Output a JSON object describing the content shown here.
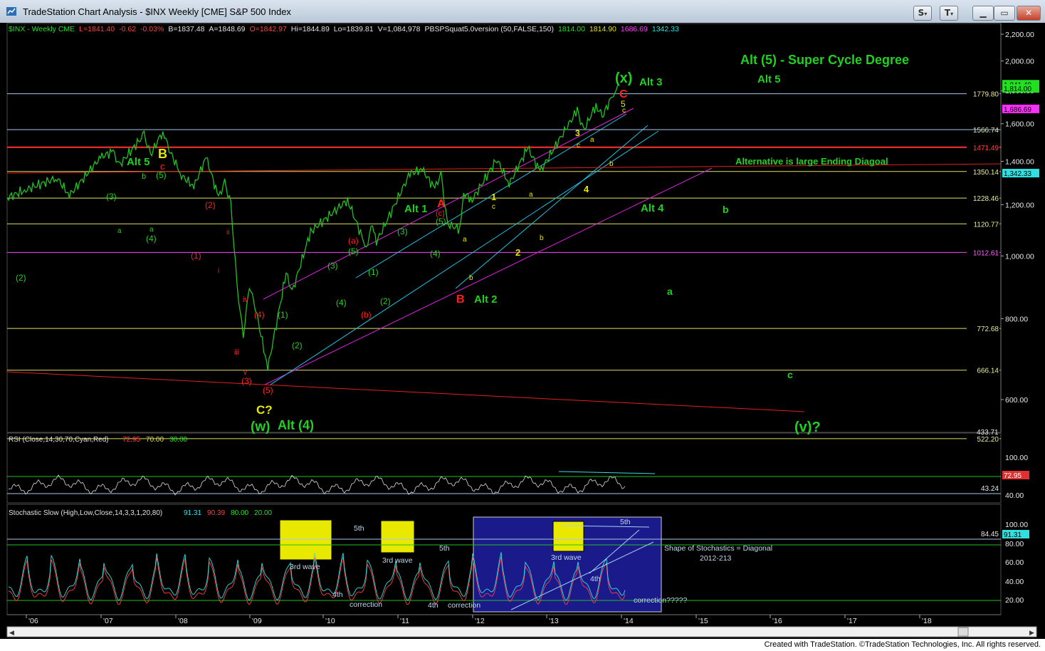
{
  "window": {
    "title": "TradeStation Chart Analysis - $INX Weekly [CME] S&P 500 Index"
  },
  "controls": {
    "s": "S",
    "t": "T"
  },
  "footer": "Created with TradeStation. ©TradeStation Technologies, Inc. All rights reserved.",
  "colors": {
    "green_label": "#22d022",
    "yellow_label": "#e8e800",
    "red_label": "#ff2020",
    "price_bar": "#22c022",
    "cyan_line": "#20c0e0",
    "magenta_line": "#e020e0",
    "red_line": "#e02020"
  },
  "header": {
    "symbol": "$INX - Weekly  CME",
    "L": "L=1841.40",
    "chg": "-0.62",
    "pct": "-0.03%",
    "B": "B=1837.48",
    "A": "A=1848.69",
    "O": "O=1842.97",
    "Hi": "Hi=1844.89",
    "Lo": "Lo=1839.81",
    "V": "V=1,084,978",
    "study": "PBSPSquat5.0version (50,FALSE,150)",
    "s1": "1814.00",
    "s2": "1814.90",
    "s3": "1686.69",
    "s4": "1342.33"
  },
  "chart_data": [
    {
      "type": "line",
      "title": "",
      "xlabel": "",
      "ylabel": "",
      "x_tick_labels": [
        "'06",
        "'07",
        "'08",
        "'09",
        "'10",
        "'11",
        "'12",
        "'13",
        "'14",
        "'15",
        "'16",
        "'17",
        "'18"
      ],
      "y_tick_labels": [
        "2,200.00",
        "2,000.00",
        "1,800.00",
        "1,600.00",
        "1,400.00",
        "1,200.00",
        "1,000.00",
        "800.00",
        "600.00"
      ],
      "ylim": [
        430,
        2260
      ],
      "scale": "log",
      "series": [
        {
          "values_date_close": [
            [
              "2005-09",
              1230
            ],
            [
              "2005-12",
              1265
            ],
            [
              "2006-05",
              1320
            ],
            [
              "2006-07",
              1240
            ],
            [
              "2006-12",
              1420
            ],
            [
              "2007-02",
              1450
            ],
            [
              "2007-03",
              1380
            ],
            [
              "2007-07",
              1540
            ],
            [
              "2007-08",
              1430
            ],
            [
              "2007-10",
              1560
            ],
            [
              "2007-11",
              1460
            ],
            [
              "2008-01",
              1330
            ],
            [
              "2008-03",
              1280
            ],
            [
              "2008-05",
              1420
            ],
            [
              "2008-07",
              1230
            ],
            [
              "2008-08",
              1300
            ],
            [
              "2008-09",
              1200
            ],
            [
              "2008-10",
              900
            ],
            [
              "2008-11",
              750
            ],
            [
              "2008-12",
              900
            ],
            [
              "2009-01",
              830
            ],
            [
              "2009-03",
              670
            ],
            [
              "2009-06",
              940
            ],
            [
              "2009-07",
              880
            ],
            [
              "2009-10",
              1090
            ],
            [
              "2010-04",
              1220
            ],
            [
              "2010-07",
              1030
            ],
            [
              "2010-08",
              1120
            ],
            [
              "2010-08-20",
              1050
            ],
            [
              "2011-02",
              1340
            ],
            [
              "2011-04",
              1360
            ],
            [
              "2011-06",
              1270
            ],
            [
              "2011-07",
              1340
            ],
            [
              "2011-08",
              1120
            ],
            [
              "2011-10",
              1100
            ],
            [
              "2011-10-20",
              1250
            ],
            [
              "2011-12",
              1220
            ],
            [
              "2012-04",
              1410
            ],
            [
              "2012-06",
              1290
            ],
            [
              "2012-09",
              1470
            ],
            [
              "2012-11",
              1350
            ],
            [
              "2013-05",
              1680
            ],
            [
              "2013-06",
              1560
            ],
            [
              "2013-08",
              1710
            ],
            [
              "2013-09",
              1640
            ],
            [
              "2013-11",
              1800
            ],
            [
              "2013-12",
              1841
            ]
          ]
        }
      ],
      "horizontal_levels": [
        {
          "value": 1779.8,
          "label": "1779.80",
          "color": "#a8c8e8"
        },
        {
          "value": 1566.74,
          "label": "1566.74",
          "color": "#e0e060"
        },
        {
          "value": 1471.49,
          "label": "1471.49",
          "color": "#ff3030"
        },
        {
          "value": 1350.14,
          "label": "1350.14",
          "color": "#e0e060"
        },
        {
          "value": 1228.46,
          "label": "1228.46",
          "color": "#e0e060"
        },
        {
          "value": 1120.77,
          "label": "1120.77",
          "color": "#e0e060"
        },
        {
          "value": 1012.61,
          "label": "1012.61",
          "color": "#ff40ff"
        },
        {
          "value": 772.68,
          "label": "772.68",
          "color": "#e0e060"
        },
        {
          "value": 666.14,
          "label": "666.14",
          "color": "#e0e060"
        },
        {
          "value": 522.2,
          "label": "522.20",
          "color": "#e0e060"
        }
      ],
      "axis_tags": [
        {
          "label": "1,841.40",
          "bg": "#20e020",
          "fg": "#000"
        },
        {
          "label": "1,814.00",
          "bg": "#20e020",
          "fg": "#000"
        },
        {
          "label": "1,686.69",
          "bg": "#ff30ff",
          "fg": "#000"
        },
        {
          "label": "1,342.33",
          "bg": "#30e0e0",
          "fg": "#000"
        }
      ],
      "truncated_tick": "433.71",
      "annotations": [
        {
          "text": "Alt (5) - Super Cycle Degree",
          "color": "green"
        },
        {
          "text": "Alt 5",
          "color": "green"
        },
        {
          "text": "(x)",
          "color": "green"
        },
        {
          "text": "Alt 3",
          "color": "green"
        },
        {
          "text": "C",
          "color": "red"
        },
        {
          "text": "5",
          "color": "yellow"
        },
        {
          "text": "c",
          "color": "yellow"
        },
        {
          "text": "Alternative is large Ending Diagoal",
          "color": "green"
        },
        {
          "text": "Alt 4",
          "color": "green"
        },
        {
          "text": "b",
          "color": "green"
        },
        {
          "text": "a",
          "color": "green"
        },
        {
          "text": "c",
          "color": "green"
        },
        {
          "text": "(v)?",
          "color": "green"
        },
        {
          "text": "Alt 5",
          "color": "green"
        },
        {
          "text": "B",
          "color": "yellow"
        },
        {
          "text": "c",
          "color": "red"
        },
        {
          "text": "(5)",
          "color": "green"
        },
        {
          "text": "b",
          "color": "green"
        },
        {
          "text": "(3)",
          "color": "green"
        },
        {
          "text": "a",
          "color": "green"
        },
        {
          "text": "a",
          "color": "green"
        },
        {
          "text": "(4)",
          "color": "green"
        },
        {
          "text": "(2)",
          "color": "green"
        },
        {
          "text": "(2)",
          "color": "red"
        },
        {
          "text": "(1)",
          "color": "red"
        },
        {
          "text": "ii",
          "color": "red"
        },
        {
          "text": "i",
          "color": "red"
        },
        {
          "text": "iv",
          "color": "red"
        },
        {
          "text": "(4)",
          "color": "red"
        },
        {
          "text": "iii",
          "color": "red"
        },
        {
          "text": "v",
          "color": "red"
        },
        {
          "text": "(3)",
          "color": "red"
        },
        {
          "text": "(5)",
          "color": "red"
        },
        {
          "text": "C?",
          "color": "yellow"
        },
        {
          "text": "(w)",
          "color": "green"
        },
        {
          "text": "Alt (4)",
          "color": "green"
        },
        {
          "text": "(1)",
          "color": "green"
        },
        {
          "text": "(2)",
          "color": "green"
        },
        {
          "text": "(3)",
          "color": "green"
        },
        {
          "text": "(4)",
          "color": "green"
        },
        {
          "text": "(a)",
          "color": "red"
        },
        {
          "text": "(5)",
          "color": "green"
        },
        {
          "text": "(1)",
          "color": "green"
        },
        {
          "text": "(2)",
          "color": "green"
        },
        {
          "text": "(b)",
          "color": "red"
        },
        {
          "text": "Alt 1",
          "color": "green"
        },
        {
          "text": "A",
          "color": "red"
        },
        {
          "text": "(c)",
          "color": "red"
        },
        {
          "text": "(3)",
          "color": "green"
        },
        {
          "text": "(5)",
          "color": "green"
        },
        {
          "text": "(4)",
          "color": "green"
        },
        {
          "text": "a",
          "color": "yellow"
        },
        {
          "text": "b",
          "color": "yellow"
        },
        {
          "text": "B",
          "color": "red"
        },
        {
          "text": "Alt 2",
          "color": "green"
        },
        {
          "text": "1",
          "color": "yellow"
        },
        {
          "text": "c",
          "color": "yellow"
        },
        {
          "text": "2",
          "color": "yellow"
        },
        {
          "text": "a",
          "color": "yellow"
        },
        {
          "text": "b",
          "color": "yellow"
        },
        {
          "text": "3",
          "color": "yellow"
        },
        {
          "text": "c",
          "color": "yellow"
        },
        {
          "text": "a",
          "color": "yellow"
        },
        {
          "text": "4",
          "color": "yellow"
        },
        {
          "text": "b",
          "color": "yellow"
        }
      ]
    },
    {
      "type": "line",
      "title": "RSI (Close,14,30,70,Cyan,Red)",
      "values_shown": [
        "72.95",
        "70.00",
        "30.00"
      ],
      "y_tick_labels": [
        "100.00",
        "80.00",
        "40.00"
      ],
      "axis_tag": "72.95",
      "level_label": "43.24"
    },
    {
      "type": "line",
      "title": "Stochastic Slow (High,Low,Close,14,3,3,1,20,80)",
      "values_shown": [
        "91.31",
        "90.39",
        "80.00",
        "20.00"
      ],
      "y_tick_labels": [
        "100.00",
        "80.00",
        "60.00",
        "40.00",
        "20.00"
      ],
      "axis_tag": "91.31",
      "level_label": "84.45",
      "annotations": [
        {
          "text": "3rd wave"
        },
        {
          "text": "5th"
        },
        {
          "text": "4th"
        },
        {
          "text": "correction"
        },
        {
          "text": "3rd wave"
        },
        {
          "text": "5th"
        },
        {
          "text": "4th"
        },
        {
          "text": "correction"
        },
        {
          "text": "3rd wave"
        },
        {
          "text": "5th"
        },
        {
          "text": "4th"
        },
        {
          "text": "correction?????"
        },
        {
          "text": "Shape of Stochastics = Diagonal"
        },
        {
          "text": "2012-213"
        }
      ]
    }
  ]
}
